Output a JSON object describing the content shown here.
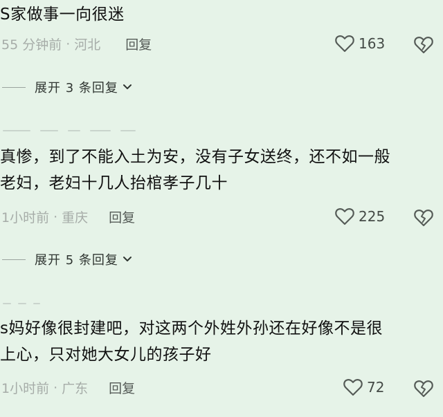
{
  "comments": [
    {
      "text_lines": [
        "S家做事一向很迷"
      ],
      "time": "55 分钟前",
      "location": "河北",
      "reply": "回复",
      "likes": "163",
      "expand": "展开 3 条回复"
    },
    {
      "text_lines": [
        "真惨，到了不能入土为安，没有子女送终，还不如一般",
        "老妇，老妇十几人抬棺孝子几十"
      ],
      "time": "1小时前",
      "location": "重庆",
      "reply": "回复",
      "likes": "225",
      "expand": "展开 5 条回复"
    },
    {
      "text_lines": [
        "s妈好像很封建吧，对这两个外姓外孙还在好像不是很",
        "上心，只对她大女儿的孩子好"
      ],
      "time": "1小时前",
      "location": "广东",
      "reply": "回复",
      "likes": "72"
    }
  ],
  "separator": "·",
  "icons": {
    "like": "heart-outline-icon",
    "dislike": "broken-heart-icon",
    "expand": "chevron-down-icon"
  },
  "colors": {
    "background": "#e6f3e8",
    "text": "#111111",
    "meta": "#a6aca8"
  }
}
